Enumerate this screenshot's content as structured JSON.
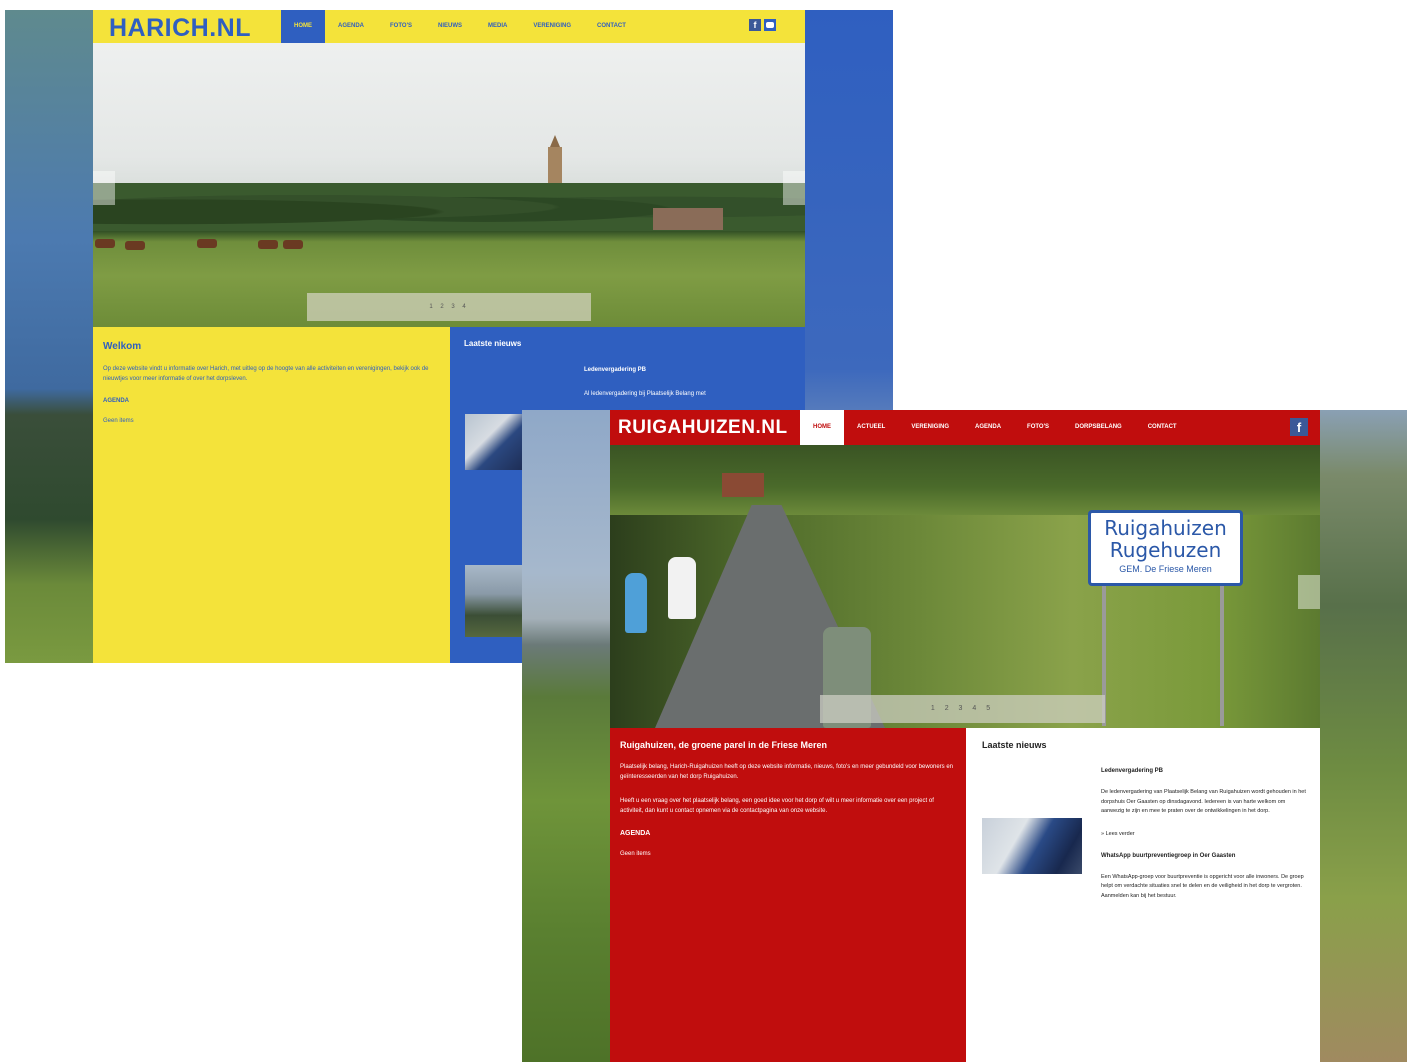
{
  "harich": {
    "logo": "HARICH.NL",
    "nav": [
      "HOME",
      "AGENDA",
      "FOTO'S",
      "NIEUWS",
      "MEDIA",
      "VERENIGING",
      "CONTACT"
    ],
    "pager": "1 2 3 4",
    "welcome_title": "Welkom",
    "welcome_text": "Op deze website vindt u informatie over Harich, met uitleg op de hoogte van alle activiteiten en verenigingen, bekijk ook de nieuwtjes voor meer informatie of over het dorpsleven.",
    "agenda_label": "AGENDA",
    "agenda_empty": "Geen items",
    "news_heading": "Laatste nieuws",
    "news_item_title": "Ledenvergadering PB",
    "news_item_line": "Al ledenvergadering bij Plaatselijk Belang met"
  },
  "ruigahuizen": {
    "logo": "RUIGAHUIZEN.NL",
    "nav": [
      "HOME",
      "ACTUEEL",
      "VERENIGING",
      "AGENDA",
      "FOTO'S",
      "DORPSBELANG",
      "CONTACT"
    ],
    "sign_line1": "Ruigahuizen",
    "sign_line2": "Rugehuzen",
    "sign_line3": "GEM. De Friese Meren",
    "pager": "1 2 3 4 5",
    "welcome_title": "Ruigahuizen, de groene parel in de Friese Meren",
    "welcome_text1": "Plaatselijk belang, Harich-Ruigahuizen heeft op deze website informatie, nieuws, foto's en meer gebundeld voor bewoners en geïnteresseerden van het dorp Ruigahuizen.",
    "welcome_text2": "Heeft u een vraag over het plaatselijk belang, een goed idee voor het dorp of wilt u meer informatie over een project of activiteit, dan kunt u contact opnemen via de contactpagina van onze website.",
    "agenda_label": "AGENDA",
    "agenda_empty": "Geen items",
    "news_heading": "Laatste nieuws",
    "news1_title": "Ledenvergadering PB",
    "news1_body": "De ledenvergadering van Plaatselijk Belang van Ruigahuizen wordt gehouden in het dorpshuis Oer Gaasten op dinsdagavond. Iedereen is van harte welkom om aanwezig te zijn en mee te praten over de ontwikkelingen in het dorp.",
    "news1_more": "» Lees verder",
    "news2_title": "WhatsApp buurtpreventiegroep in Oer Gaasten",
    "news2_body": "Een WhatsApp-groep voor buurtpreventie is opgericht voor alle inwoners. De groep helpt om verdachte situaties snel te delen en de veiligheid in het dorp te vergroten. Aanmelden kan bij het bestuur."
  },
  "colors": {
    "harich_yellow": "#f4e33a",
    "harich_blue": "#2f5fc0",
    "ruiga_red": "#c00d0d"
  },
  "icons": [
    "facebook-icon",
    "flag-icon",
    "slider-arrow-icon"
  ]
}
